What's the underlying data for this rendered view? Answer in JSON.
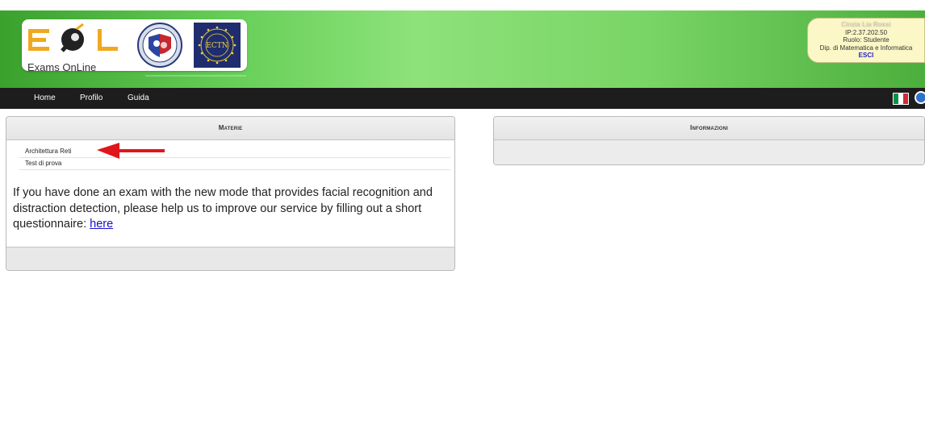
{
  "header": {
    "logo_text": "Exams OnLine",
    "seal_label": "ECTN"
  },
  "user": {
    "name": "Cinzia Lia Rossi",
    "ip": "IP:2.37.202.50",
    "role": "Ruolo: Studente",
    "department": "Dip. di Matematica e Informatica",
    "logout": "ESCI"
  },
  "nav": {
    "items": [
      "Home",
      "Profilo",
      "Guida"
    ],
    "flag_colors": [
      "#009246",
      "#ffffff",
      "#ce2b37"
    ]
  },
  "materie": {
    "title": "Materie",
    "subjects": [
      "Architettura Reti",
      "Test di prova"
    ],
    "notice_text": "If you have done an exam with the new mode that provides facial recognition and distraction detection, please help us to improve our service by filling out a short questionnaire: ",
    "notice_link": "here"
  },
  "informazioni": {
    "title": "Informazioni"
  },
  "colors": {
    "header_green": "#6fd35c",
    "nav_bg": "#1d1d1d",
    "arrow_red": "#e0161b",
    "link_blue": "#1a0dcc"
  }
}
